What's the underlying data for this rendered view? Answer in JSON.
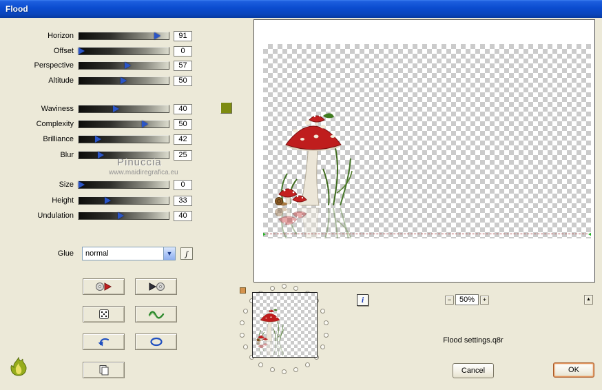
{
  "window": {
    "title": "Flood"
  },
  "sliders": {
    "items": [
      {
        "label": "Horizon",
        "value": "91",
        "pos": 0.88
      },
      {
        "label": "Offset",
        "value": "0",
        "pos": 0.04
      },
      {
        "label": "Perspective",
        "value": "57",
        "pos": 0.55
      },
      {
        "label": "Altitude",
        "value": "50",
        "pos": 0.5
      },
      {
        "label": "Waviness",
        "value": "40",
        "pos": 0.42
      },
      {
        "label": "Complexity",
        "value": "50",
        "pos": 0.74
      },
      {
        "label": "Brilliance",
        "value": "42",
        "pos": 0.22
      },
      {
        "label": "Blur",
        "value": "25",
        "pos": 0.25
      },
      {
        "label": "Size",
        "value": "0",
        "pos": 0.04
      },
      {
        "label": "Height",
        "value": "33",
        "pos": 0.33
      },
      {
        "label": "Undulation",
        "value": "40",
        "pos": 0.47
      }
    ]
  },
  "swatch": {
    "color": "#7d8b10"
  },
  "glue": {
    "label": "Glue",
    "selected": "normal",
    "script_button_label": "ʃ",
    "dropdown_arrow": "▼"
  },
  "icon_buttons": [
    {
      "name": "load-preset-button",
      "icon": "disc-with-play"
    },
    {
      "name": "save-preset-button",
      "icon": "play-with-disc"
    },
    {
      "name": "random-dice-button",
      "icon": "dice"
    },
    {
      "name": "wave-button",
      "icon": "green-wave"
    },
    {
      "name": "undo-button",
      "icon": "undo-arrow"
    },
    {
      "name": "circle-button",
      "icon": "blue-ellipse"
    },
    {
      "name": "copy-button",
      "icon": "pages"
    }
  ],
  "watermark": {
    "name": "Pinuccia",
    "url": "www.maidiregrafica.eu"
  },
  "preview": {
    "info_label": "i",
    "corner_button_label": "▲",
    "zoom": {
      "minus_label": "−",
      "value": "50%",
      "plus_label": "+"
    },
    "settings_text": "Flood settings.q8r"
  },
  "actions": {
    "cancel_label": "Cancel",
    "ok_label": "OK"
  }
}
